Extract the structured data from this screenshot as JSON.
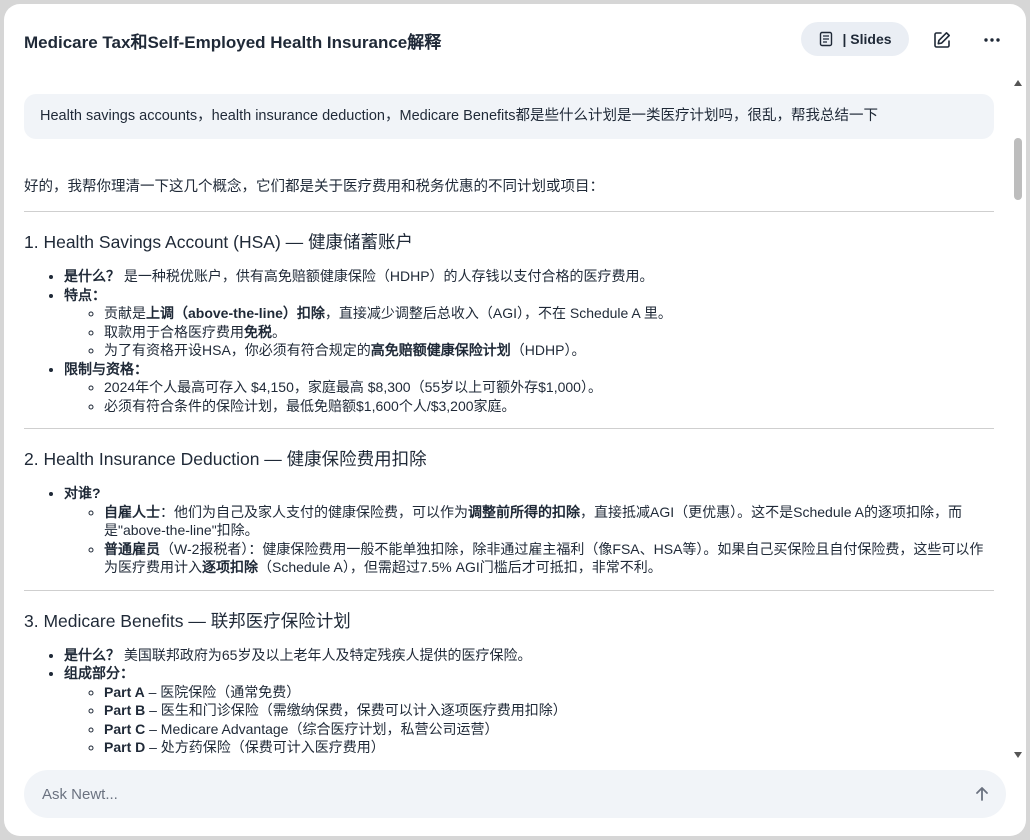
{
  "header": {
    "title": "Medicare Tax和Self-Employed Health Insurance解释",
    "slides_label": "| Slides",
    "slides_icon": "slides-icon",
    "edit_icon": "edit-icon",
    "more_icon": "more-icon"
  },
  "user_message": "Health savings accounts，health insurance deduction，Medicare Benefits都是些什么计划是一类医疗计划吗，很乱，帮我总结一下",
  "answer": {
    "intro": "好的，我帮你理清一下这几个概念，它们都是关于医疗费用和税务优惠的不同计划或项目：",
    "s1": {
      "heading": "1. Health Savings Account (HSA) — 健康储蓄账户",
      "what_label": "是什么？",
      "what_text": " 是一种税优账户，供有高免赔额健康保险（HDHP）的人存钱以支付合格的医疗费用。",
      "features_label": "特点：",
      "f1_a": "贡献是",
      "f1_b": "上调（above-the-line）扣除",
      "f1_c": "，直接减少调整后总收入（AGI），不在 Schedule A 里。",
      "f2_a": "取款用于合格医疗费用",
      "f2_b": "免税",
      "f2_c": "。",
      "f3_a": "为了有资格开设HSA，你必须有符合规定的",
      "f3_b": "高免赔额健康保险计划",
      "f3_c": "（HDHP）。",
      "limits_label": "限制与资格：",
      "l1": "2024年个人最高可存入 $4,150，家庭最高 $8,300（55岁以上可额外存$1,000）。",
      "l2": "必须有符合条件的保险计划，最低免赔额$1,600个人/$3,200家庭。"
    },
    "s2": {
      "heading": "2. Health Insurance Deduction — 健康保险费用扣除",
      "who_label": "对谁?",
      "w1_a": "自雇人士",
      "w1_b": "：他们为自己及家人支付的健康保险费，可以作为",
      "w1_c": "调整前所得的扣除",
      "w1_d": "，直接抵减AGI（更优惠）。这不是Schedule A的逐项扣除，而是\"above-the-line\"扣除。",
      "w2_a": "普通雇员",
      "w2_b": "（W-2报税者）：健康保险费用一般不能单独扣除，除非通过雇主福利（像FSA、HSA等）。如果自己买保险且自付保险费，这些可以作为医疗费用计入",
      "w2_c": "逐项扣除",
      "w2_d": "（Schedule A），但需超过7.5% AGI门槛后才可抵扣，非常不利。"
    },
    "s3": {
      "heading": "3. Medicare Benefits — 联邦医疗保险计划",
      "what_label": "是什么？",
      "what_text": " 美国联邦政府为65岁及以上老年人及特定残疾人提供的医疗保险。",
      "parts_label": "组成部分：",
      "pa_label": "Part A",
      "pa_text": " – 医院保险（通常免费）",
      "pb_label": "Part B",
      "pb_text": " – 医生和门诊保险（需缴纳保费，保费可以计入逐项医疗费用扣除）",
      "pc_label": "Part C",
      "pc_text": " – Medicare Advantage（综合医疗计划，私营公司运营）",
      "pd_label": "Part D",
      "pd_text": " – 处方药保险（保费可计入医疗费用）"
    }
  },
  "composer": {
    "placeholder": "Ask Newt...",
    "send_icon": "send-arrow-icon"
  }
}
